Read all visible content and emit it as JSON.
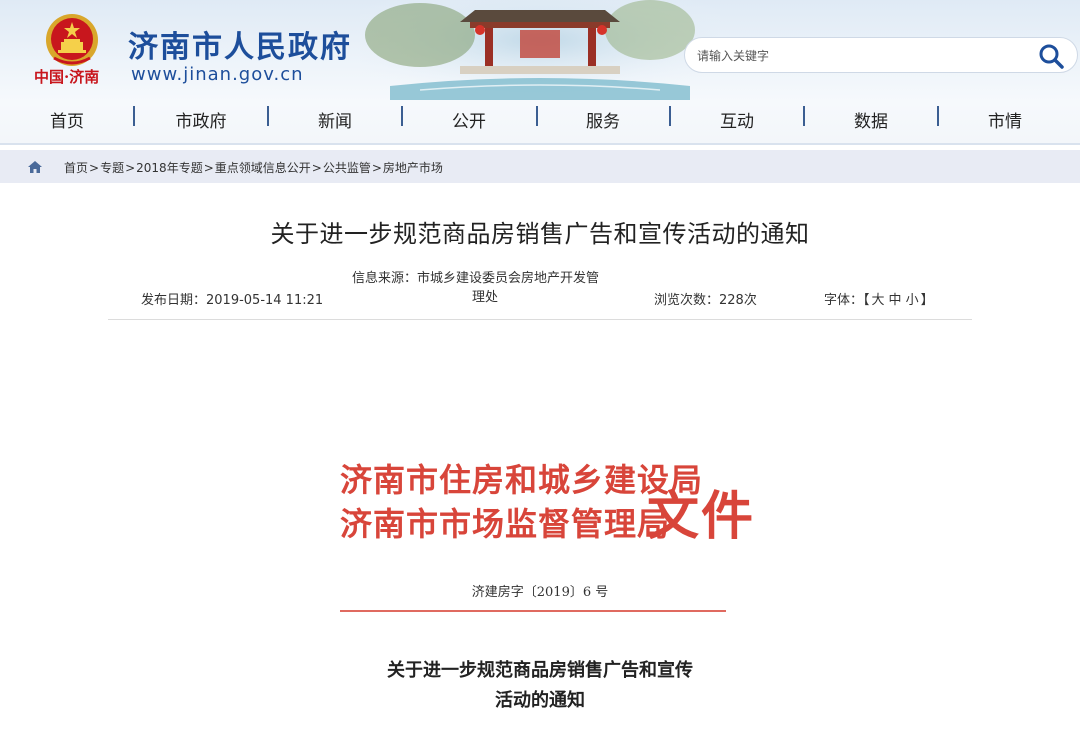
{
  "header": {
    "emblem_label": "中国·济南",
    "site_title": "济南市人民政府",
    "site_url": "www.jinan.gov.cn",
    "search": {
      "placeholder": "请输入关键字"
    }
  },
  "nav": {
    "items": [
      "首页",
      "市政府",
      "新闻",
      "公开",
      "服务",
      "互动",
      "数据",
      "市情"
    ]
  },
  "breadcrumb": {
    "items": [
      "首页",
      "专题",
      "2018年专题",
      "重点领域信息公开",
      "公共监管",
      "房地产市场"
    ],
    "separator": ">"
  },
  "article": {
    "title": "关于进一步规范商品房销售广告和宣传活动的通知",
    "source_line1": "信息来源：市城乡建设委员会房地产开发管",
    "source_line2": "理处",
    "publish_date": "发布日期：2019-05-14 11:21",
    "views": "浏览次数：228次",
    "font_label": "字体：",
    "font_open": "【",
    "font_large": "大",
    "font_medium": "中",
    "font_small": "小",
    "font_close": "】"
  },
  "document": {
    "issuer_line1": "济南市住房和城乡建设局",
    "issuer_line2": "济南市市场监督管理局",
    "doc_word": "文件",
    "doc_number": "济建房字〔2019〕6 号",
    "title_line1": "关于进一步规范商品房销售广告和宣传",
    "title_line2": "活动的通知"
  },
  "colors": {
    "brand_blue": "#1d4e9b",
    "doc_red": "#d8453a",
    "breadcrumb_bg": "#e8ebf4"
  }
}
